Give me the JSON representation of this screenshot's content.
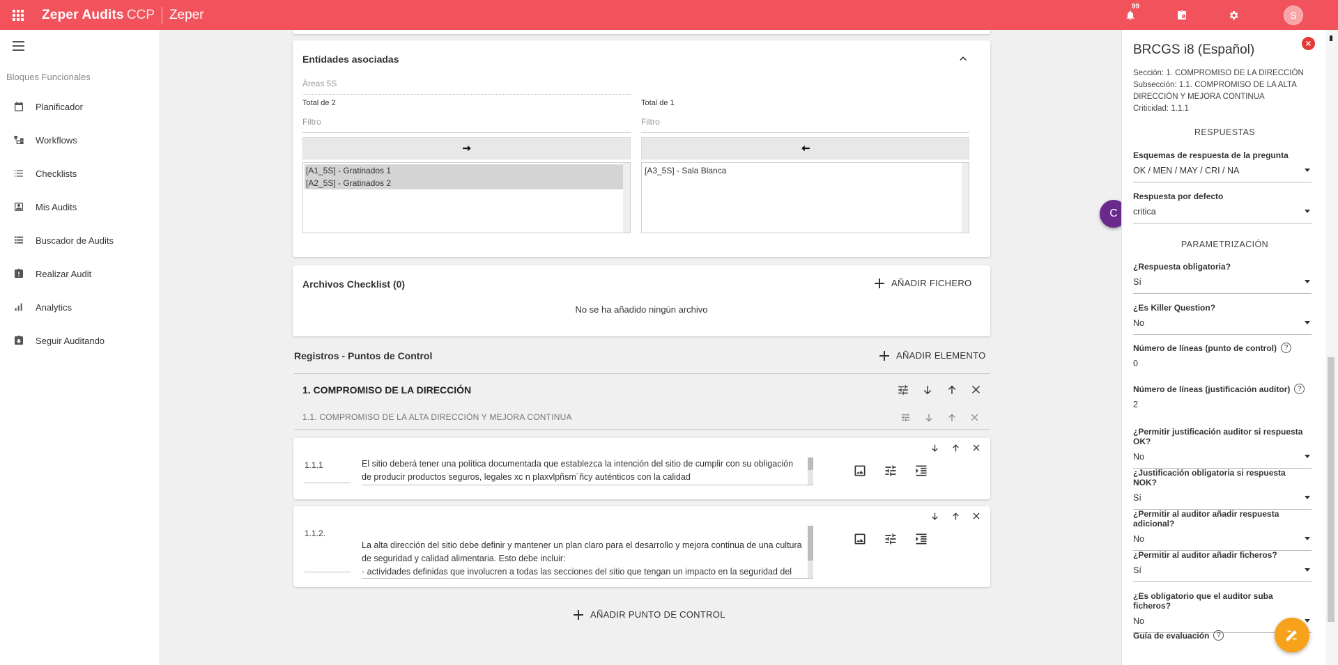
{
  "topbar": {
    "brand": "Zeper Audits",
    "brand_suffix": "CCP",
    "tenant": "Zeper",
    "notifications": "99",
    "avatar_initial": "S"
  },
  "sidebar": {
    "heading": "Bloques Funcionales",
    "items": [
      {
        "label": "Planificador",
        "icon": "calendar-icon"
      },
      {
        "label": "Workflows",
        "icon": "workflow-icon"
      },
      {
        "label": "Checklists",
        "icon": "list-icon"
      },
      {
        "label": "Mis Audits",
        "icon": "contact-icon"
      },
      {
        "label": "Buscador de Audits",
        "icon": "list-search-icon"
      },
      {
        "label": "Realizar Audit",
        "icon": "clipboard-alert-icon"
      },
      {
        "label": "Analytics",
        "icon": "bar-chart-icon"
      },
      {
        "label": "Seguir Auditando",
        "icon": "clipboard-download-icon"
      }
    ]
  },
  "entidades": {
    "title": "Entidades asociadas",
    "areas_label": "Áreas 5S",
    "left": {
      "total": "Total de 2",
      "filter_placeholder": "Filtro",
      "options": [
        "[A1_5S] - Gratinados 1",
        "[A2_5S] - Gratinados 2"
      ]
    },
    "right": {
      "total": "Total de 1",
      "filter_placeholder": "Filtro",
      "options": [
        "[A3_5S] - Sala Blanca"
      ]
    }
  },
  "archivos": {
    "title": "Archivos Checklist (0)",
    "add_label": "AÑADIR FICHERO",
    "empty": "No se ha añadido ningún archivo"
  },
  "registros": {
    "title": "Registros - Puntos de Control",
    "add_label": "AÑADIR ELEMENTO",
    "section": "1. COMPROMISO DE LA DIRECCIÓN",
    "subsection": "1.1. COMPROMISO DE LA ALTA DIRECCIÓN Y MEJORA CONTINUA",
    "points": [
      {
        "num": "1.1.1",
        "text": "El sitio deberá tener una política documentada que establezca la intención del sitio de cumplir con su obligación de producir productos seguros, legales xc n plaxvlpñsm´ñcy auténticos con la calidad"
      },
      {
        "num": "1.1.2.",
        "text": "La alta dirección del sitio debe definir y mantener un plan claro para el desarrollo y mejora continua de una cultura de seguridad y calidad alimentaria. Esto debe incluir:\n· actividades definidas que involucren a todas las secciones del sitio que tengan un impacto en la seguridad del producto."
      }
    ],
    "add_point_label": "AÑADIR PUNTO DE CONTROL"
  },
  "badge": "C",
  "panel": {
    "title": "BRCGS i8 (Español)",
    "seccion": "Sección: 1. COMPROMISO DE LA DIRECCIÓN",
    "subseccion": "Subsección: 1.1. COMPROMISO DE LA ALTA DIRECCIÓN Y MEJORA CONTINUA",
    "criticidad": "Criticidad: 1.1.1",
    "respuestas_heading": "RESPUESTAS",
    "esquemas_label": "Esquemas de respuesta de la pregunta",
    "esquemas_value": "OK / MEN / MAY / CRI / NA",
    "defecto_label": "Respuesta por defecto",
    "defecto_value": "critica",
    "param_heading": "PARAMETRIZACIÓN",
    "obligatoria_label": "¿Respuesta obligatoria?",
    "obligatoria_value": "Sí",
    "killer_label": "¿Es Killer Question?",
    "killer_value": "No",
    "lineas_pc_label": "Número de líneas (punto de control)",
    "lineas_pc_value": "0",
    "lineas_ja_label": "Número de líneas (justificación auditor)",
    "lineas_ja_value": "2",
    "perm_just_label": "¿Permitir justificación auditor si respuesta OK?",
    "perm_just_value": "No",
    "just_oblig_label": "¿Justificación obligatoria si respuesta NOK?",
    "just_oblig_value": "Sí",
    "perm_adic_label": "¿Permitir al auditor añadir respuesta adicional?",
    "perm_adic_value": "No",
    "perm_fich_label": "¿Permitir al auditor añadir ficheros?",
    "perm_fich_value": "Sí",
    "oblig_fich_label": "¿Es obligatorio que el auditor suba ficheros?",
    "oblig_fich_value": "No",
    "guia_label": "Guía de evaluación",
    "help_glyph": "?"
  },
  "colors": {
    "topbar": "#f2525b",
    "badge": "#6a2a8c",
    "fab": "#f7a21b",
    "close": "#e53935"
  }
}
